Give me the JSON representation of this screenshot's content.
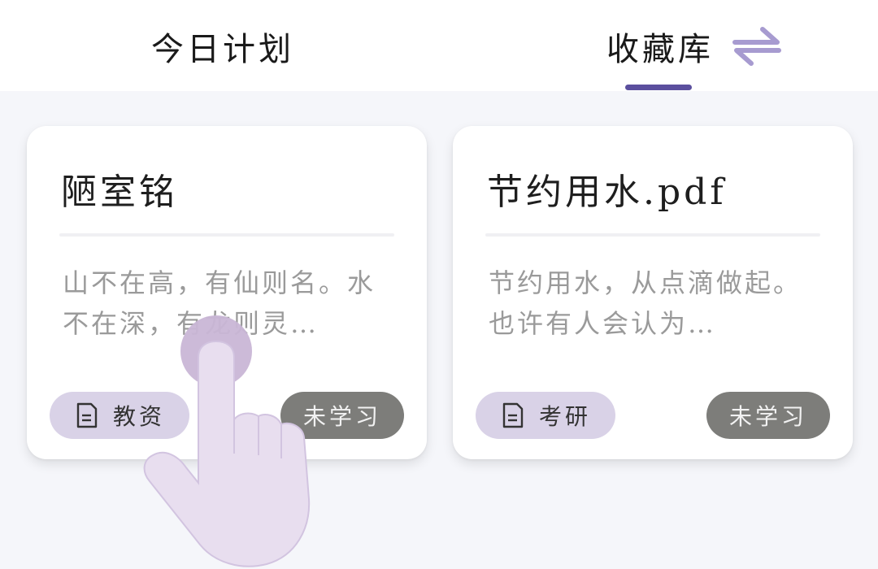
{
  "header": {
    "tabs": [
      {
        "label": "今日计划"
      },
      {
        "label": "收藏库",
        "active": true
      }
    ],
    "switch_icon": "swap-arrows-icon",
    "accent_color": "#5b4f9e"
  },
  "cards": [
    {
      "title": "陋室铭",
      "excerpt": "山不在高，有仙则名。水不在深，有龙则灵…",
      "tag": {
        "icon": "document-icon",
        "label": "教资"
      },
      "status": "未学习"
    },
    {
      "title": "节约用水.pdf",
      "excerpt": "节约用水，从点滴做起。也许有人会认为…",
      "tag": {
        "icon": "document-icon",
        "label": "考研"
      },
      "status": "未学习"
    }
  ],
  "overlay": {
    "icon": "tap-gesture-hand-icon"
  }
}
